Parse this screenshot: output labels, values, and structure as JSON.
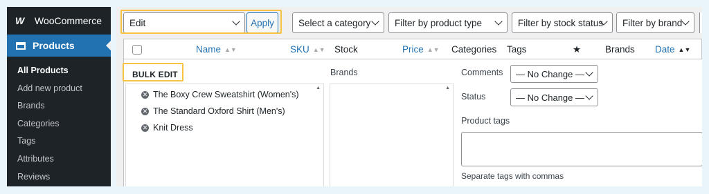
{
  "sidebar": {
    "brand": "WooCommerce",
    "brand_logo": "W",
    "current_menu": "Products",
    "items": [
      {
        "label": "All Products",
        "active": true
      },
      {
        "label": "Add new product"
      },
      {
        "label": "Brands"
      },
      {
        "label": "Categories"
      },
      {
        "label": "Tags"
      },
      {
        "label": "Attributes"
      },
      {
        "label": "Reviews"
      }
    ]
  },
  "toolbar": {
    "bulk_action_value": "Edit",
    "apply_label": "Apply",
    "filters": [
      "Select a category",
      "Filter by product type",
      "Filter by stock status",
      "Filter by brand"
    ]
  },
  "table": {
    "columns": {
      "name": "Name",
      "sku": "SKU",
      "stock": "Stock",
      "price": "Price",
      "categories": "Categories",
      "tags": "Tags",
      "featured": "★",
      "brands": "Brands",
      "date": "Date"
    }
  },
  "bulk_edit": {
    "title": "BULK EDIT",
    "products": [
      "The Boxy Crew Sweatshirt (Women's)",
      "The Standard Oxford Shirt (Men's)",
      "Knit Dress"
    ],
    "brands_label": "Brands",
    "comments_label": "Comments",
    "comments_value": "— No Change —",
    "status_label": "Status",
    "status_value": "— No Change —",
    "product_tags_label": "Product tags",
    "tags_hint": "Separate tags with commas"
  },
  "colors": {
    "accent": "#2271b1",
    "highlight": "#f5c242",
    "sidebar_bg": "#1d2327"
  }
}
